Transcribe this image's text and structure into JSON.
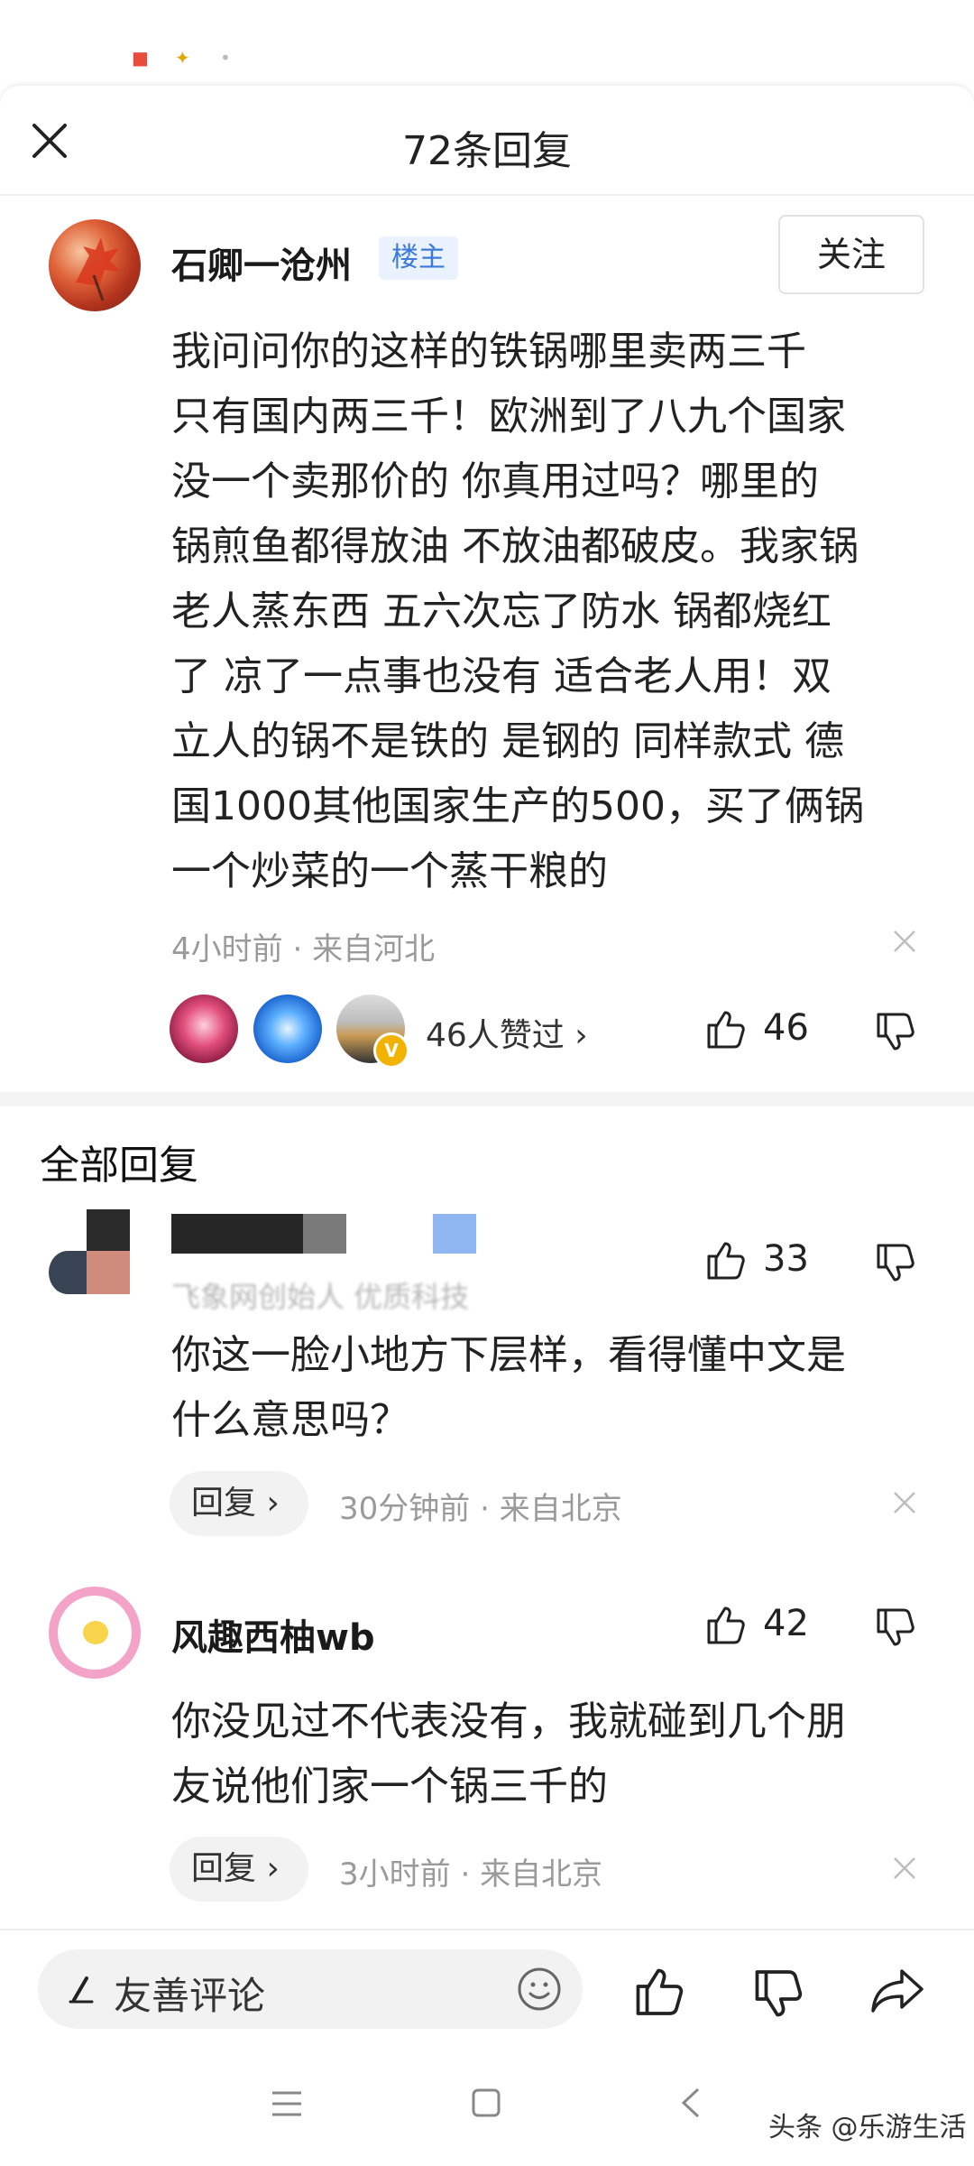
{
  "header": {
    "title": "72条回复"
  },
  "op": {
    "username": "石卿一沧州",
    "badge": "楼主",
    "follow_label": "关注",
    "lines": [
      "我问问你的这样的铁锅哪里卖两三千",
      "只有国内两三千！欧洲到了八九个国家",
      "没一个卖那价的 你真用过吗？哪里的",
      "锅煎鱼都得放油 不放油都破皮。我家锅",
      "老人蒸东西 五六次忘了防水 锅都烧红",
      "了 凉了一点事也没有 适合老人用！双",
      "立人的锅不是铁的 是钢的 同样款式 德",
      "国1000其他国家生产的500，买了俩锅",
      "一个炒菜的一个蒸干粮的"
    ],
    "time": "4小时前",
    "location": "来自河北",
    "likes_summary": "46人赞过",
    "like_count": "46"
  },
  "section_title": "全部回复",
  "replies": [
    {
      "sub": "飞象网创始人 优质科技",
      "lines": [
        "你这一脸小地方下层样，看得懂中文是",
        "什么意思吗？"
      ],
      "reply_label": "回复",
      "time": "30分钟前",
      "location": "来自北京",
      "like_count": "33"
    },
    {
      "username": "风趣西柚wb",
      "lines": [
        "你没见过不代表没有，我就碰到几个朋",
        "友说他们家一个锅三千的"
      ],
      "reply_label": "回复",
      "time": "3小时前",
      "location": "来自北京",
      "like_count": "42"
    }
  ],
  "bottom_bar": {
    "comment_placeholder": "友善评论"
  },
  "watermark": "头条 @乐游生活",
  "colors": {
    "badge_blue": "#3c7ad9",
    "meta_gray": "#9a9a9a",
    "follow_border": "#e2e2e2"
  }
}
